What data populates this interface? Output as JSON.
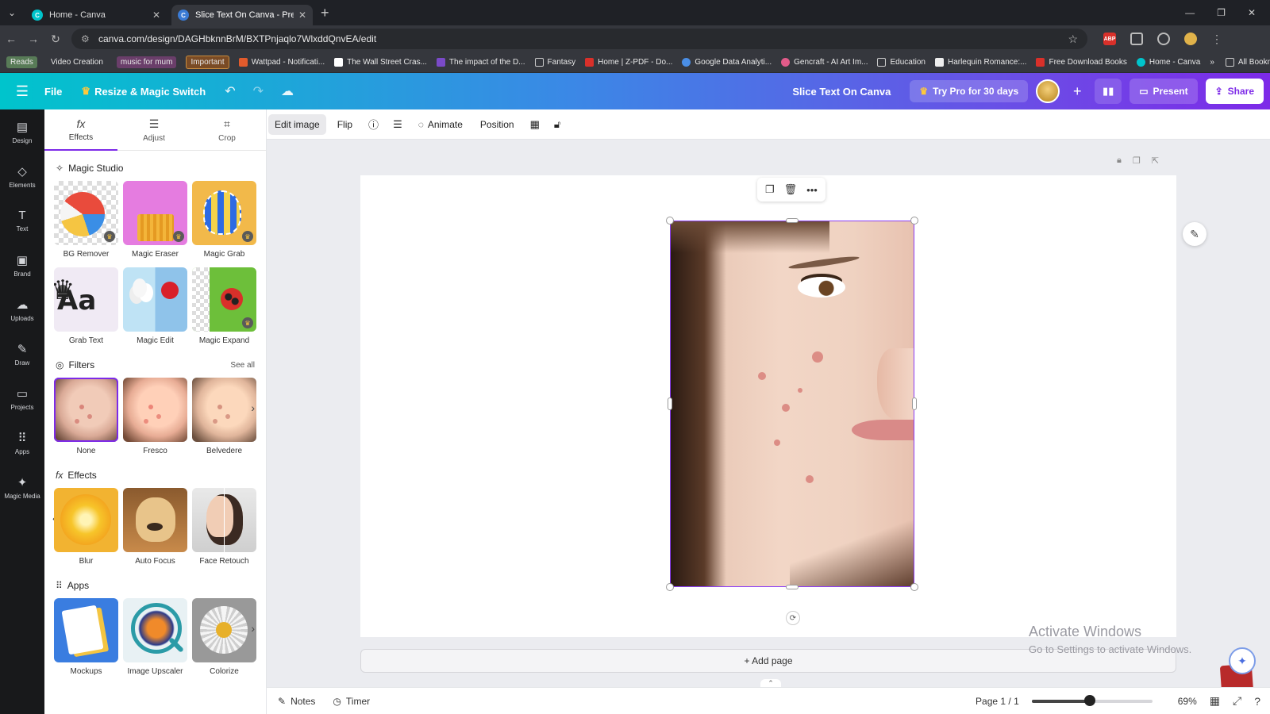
{
  "browser": {
    "tabs": [
      {
        "title": "Home - Canva",
        "active": false
      },
      {
        "title": "Slice Text On Canva - Presentation",
        "active": true
      }
    ],
    "url": "canva.com/design/DAGHbknnBrM/BXTPnjaqlo7WlxddQnvEA/edit",
    "bookmarks": [
      {
        "label": "Reads",
        "style": "green"
      },
      {
        "label": "Video Creation",
        "style": "plain"
      },
      {
        "label": "music for mum",
        "style": "purple"
      },
      {
        "label": "Important",
        "style": "orange"
      },
      {
        "label": "Wattpad - Notificati...",
        "icon_color": "#e25b2c"
      },
      {
        "label": "The Wall Street Cras...",
        "icon_color": "#ffffff"
      },
      {
        "label": "The impact of the D...",
        "icon_color": "#7a4ac8"
      },
      {
        "label": "Fantasy",
        "icon_color": "#cccccc"
      },
      {
        "label": "Home | Z-PDF - Do...",
        "icon_color": "#d9302a"
      },
      {
        "label": "Google Data Analyti...",
        "icon_color": "#4a8ee6"
      },
      {
        "label": "Gencraft - AI Art Im...",
        "icon_color": "#e25b8a"
      },
      {
        "label": "Education",
        "icon_color": "#cccccc"
      },
      {
        "label": "Harlequin Romance:...",
        "icon_color": "#eeeeee"
      },
      {
        "label": "Free Download Books",
        "icon_color": "#d9302a"
      },
      {
        "label": "Home - Canva",
        "icon_color": "#00c4cc"
      }
    ],
    "all_bookmarks": "All Bookmarks"
  },
  "header": {
    "file": "File",
    "resize": "Resize & Magic Switch",
    "doc_title": "Slice Text On Canva",
    "try_pro": "Try Pro for 30 days",
    "present": "Present",
    "share": "Share"
  },
  "rail": [
    {
      "label": "Design",
      "icon": "layout-icon"
    },
    {
      "label": "Elements",
      "icon": "shapes-icon"
    },
    {
      "label": "Text",
      "icon": "text-icon"
    },
    {
      "label": "Brand",
      "icon": "briefcase-icon"
    },
    {
      "label": "Uploads",
      "icon": "cloud-upload-icon"
    },
    {
      "label": "Draw",
      "icon": "pen-icon"
    },
    {
      "label": "Projects",
      "icon": "folder-icon"
    },
    {
      "label": "Apps",
      "icon": "apps-grid-icon"
    },
    {
      "label": "Magic Media",
      "icon": "magic-media-icon"
    }
  ],
  "panel": {
    "tabs": [
      "Effects",
      "Adjust",
      "Crop"
    ],
    "magic_studio": {
      "title": "Magic Studio",
      "items": [
        "BG Remover",
        "Magic Eraser",
        "Magic Grab",
        "Grab Text",
        "Magic Edit",
        "Magic Expand"
      ]
    },
    "filters": {
      "title": "Filters",
      "see_all": "See all",
      "items": [
        "None",
        "Fresco",
        "Belvedere"
      ]
    },
    "effects": {
      "title": "Effects",
      "items": [
        "Blur",
        "Auto Focus",
        "Face Retouch"
      ]
    },
    "apps": {
      "title": "Apps",
      "items": [
        "Mockups",
        "Image Upscaler",
        "Colorize"
      ]
    },
    "grab_text_glyph": "Aa"
  },
  "toolbar": {
    "edit_image": "Edit image",
    "flip": "Flip",
    "animate": "Animate",
    "position": "Position"
  },
  "canvas": {
    "add_page": "+ Add page",
    "watermark_line1": "Activate Windows",
    "watermark_line2": "Go to Settings to activate Windows."
  },
  "bottom": {
    "notes": "Notes",
    "timer": "Timer",
    "page_indicator": "Page 1 / 1",
    "zoom": "69%",
    "zoom_fraction": 0.48
  },
  "colors": {
    "accent": "#7d2ae8",
    "header_start": "#00c4cc",
    "header_end": "#7d2ae8"
  }
}
